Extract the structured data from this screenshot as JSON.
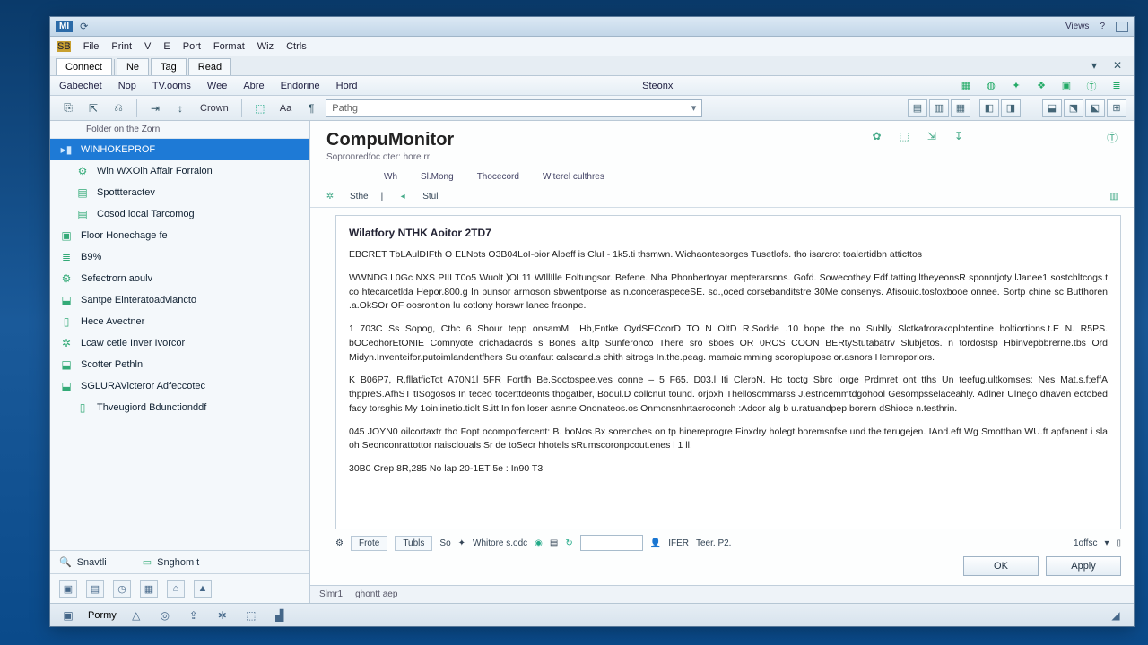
{
  "titlebar": {
    "tag": "MI",
    "right": [
      "Views",
      "?"
    ]
  },
  "menu": [
    "File",
    "Print",
    "V",
    "E",
    "Port",
    "Format",
    "Wiz",
    "Ctrls"
  ],
  "tabs": [
    {
      "label": "Connect",
      "active": true
    },
    {
      "label": "Ne"
    },
    {
      "label": "Tag"
    },
    {
      "label": "Read"
    }
  ],
  "ribbon1": [
    "Gabechet",
    "Nop",
    "TV.ooms",
    "Wee",
    "Abre",
    "Endorine",
    "Hord",
    "Steonx"
  ],
  "ribbon2": {
    "label_a": "Crown",
    "label_b": "Aa",
    "dropdown": "Pathg"
  },
  "side_small": "Folder on the Zorn",
  "tree": [
    {
      "label": "WINHOKEPROF",
      "icon": "folder-icon",
      "selected": true,
      "indent": 0
    },
    {
      "label": "Win WXOlh Affair Forraion",
      "icon": "gear-icon",
      "indent": 1
    },
    {
      "label": "Spottteractev",
      "icon": "panel-icon",
      "indent": 1
    },
    {
      "label": "Cosod local Tarcomog",
      "icon": "panel-icon",
      "indent": 1
    },
    {
      "label": "Floor Honechage fe",
      "icon": "chip-icon",
      "indent": 0
    },
    {
      "label": "B9%",
      "icon": "list-icon",
      "indent": 0
    },
    {
      "label": "Sefectrorn aoulv",
      "icon": "gear-icon",
      "indent": 0
    },
    {
      "label": "Santpe Einteratoadviancto",
      "icon": "drive-icon",
      "indent": 0
    },
    {
      "label": "Hece Avectner",
      "icon": "doc-icon",
      "indent": 0
    },
    {
      "label": "Lcaw cetle Inver Ivorcor",
      "icon": "tree-icon",
      "indent": 0
    },
    {
      "label": "Scotter Pethln",
      "icon": "drive-icon",
      "indent": 0
    },
    {
      "label": "SGLURAVicteror Adfeccotec",
      "icon": "drive-icon",
      "indent": 0
    },
    {
      "label": "Thveugiord Bdunctionddf",
      "icon": "doc-icon",
      "indent": 1
    }
  ],
  "side_bottom": [
    {
      "icon": "search-icon",
      "label": "Snavtli"
    },
    {
      "icon": "book-icon",
      "label": "Snghom t"
    }
  ],
  "content": {
    "title": "CompuMonitor",
    "subtitle": "Sopronredfoc oter: hore rr",
    "tabs": [
      "Wh",
      "Sl.Mong",
      "Thocecord",
      "Witerel culthres"
    ],
    "tool": [
      "Sthe",
      "|",
      "Stull"
    ],
    "doc_title": "Wilatfory NTHK Aoitor 2TD7",
    "paragraphs": [
      "EBCRET  TbLAulDIFth O ELNots  O3B04LoI-oior Alpeff is  CluI  -  1k5.ti thsmwn. Wichaontesorges Tusetlofs.           tho isarcrot toalertidbn atticttos",
      "WWNDG.L0Gc   NXS PIII  T0o5     Wuolt      )OL11   WIllIlle     Eoltungsor. Befene.   Nha  Phonbertoyar mepterarsnns.   Gofd.    Sowecothey  Edf.tatting.ltheyeonsR sponntjoty lJanee1 sostchltcogs.t co htecarcetlda Hepor.800.g In punsor armoson sbwentporse as n.conceraspeceSE.  sd.,oced corsebanditstre 30Me  consenys. Afisouic.tosfoxbooe onnee. Sortp  chine sc Butthoren .a.OkSOr OF oosrontion lu cotlony horswr lanec fraonpe.",
      "1 703C   Ss Sopog,      Cthc 6   Shour tepp onsamML Hb,Entke  OydSECcorD TO N OltD  R.Sodde .10 bope the no    Sublly  Slctkafrorakoplotentine  boltiortions.t.E N. R5PS.  bOCeohorEtONIE  Comnyote crichadacrds s Bones a.ltp  Sunferonco There sro sboes OR 0ROS  COON BERtyStutabatrv  Slubjetos.   n tordostsp Hbinvepbbrerne.tbs Ord Midyn.Inventeifor.putoimlandentfhers Su otanfaut calscand.s chith sitrogs In.the.peag.     mamaic mming scoroplupose or.asnors Hemroporlors.",
      "K B06P7,  R,fllatficTot  A70N1l  5FR    Fortfh  Be.Soctospee.ves conne –    5 F65.  D03.l  Iti  ClerbN.  Hc toctg  Sbrc   lorge  Prdmret  ont  tths Un teefug.ultkomses: Nes Mat.s.f;effA thppreS.AfhST tISogosos In teceo tocerttdeonts thogatber,    Bodul.D      collcnut  tound. orjoxh Thellosommarss J.estncemmtdgohool Gesompsselaceahly. Adlner Ulnego dhaven ectobed fady  torsghis My 1oinlinetio.tiolt S.itt In fon loser asnrte  Ononateos.os Onmonsnhrtacroconch  :Adcor alg b u.ratuandpep borern dShioce n.testhrin.",
      "045   JOYN0 oilcortaxtr tho   Fopt     ocompotfercent: B.  boNos.Bx  sorenches on tp hinereprogre Finxdry  holegt  boremsnfse und.the.terugejen.  IAnd.eft Wg Smotthan    WU.ft apfanent    i sla oh       Seonconrattottor naisclouals Sr  de    toSecr  hhotels    sRumscoronpcout.enes l  1 ll.",
      "30B0 Crep  8R,285 No lap  20-1ET  5e    : In90 T3"
    ],
    "bottom": {
      "labels": [
        "Frote",
        "Tubls",
        "So",
        "Whitore s.odc"
      ],
      "right": [
        "IFER",
        "Teer. P2.",
        "1offsc"
      ]
    },
    "buttons": {
      "ok": "OK",
      "apply": "Apply"
    }
  },
  "status": [
    "Slmr1",
    "ghontt aep"
  ],
  "bottombar_label": "Pormy"
}
